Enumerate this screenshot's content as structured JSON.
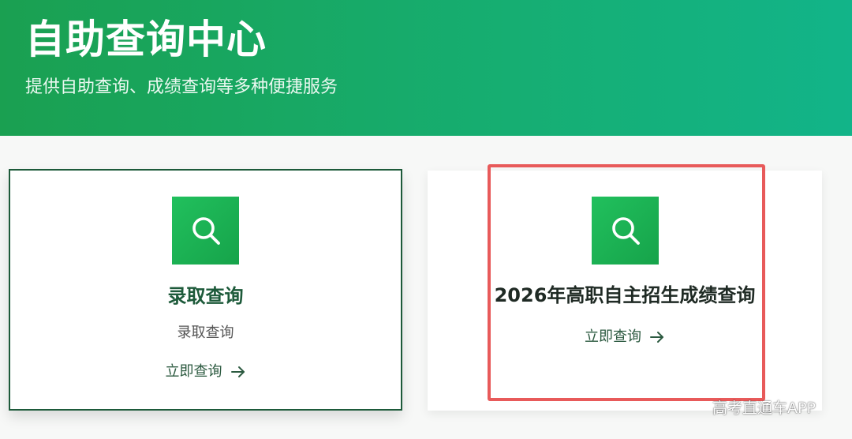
{
  "header": {
    "title": "自助查询中心",
    "subtitle": "提供自助查询、成绩查询等多种便捷服务"
  },
  "colors": {
    "brand_green": "#16a34a",
    "dark_green": "#1d5a3a",
    "highlight_red": "#e85a5a"
  },
  "cards": [
    {
      "icon": "search-icon",
      "title": "录取查询",
      "description": "录取查询",
      "action_label": "立即查询"
    },
    {
      "icon": "search-icon",
      "title": "2026年高职自主招生成绩查询",
      "action_label": "立即查询"
    }
  ],
  "watermark": "高考直通车APP"
}
